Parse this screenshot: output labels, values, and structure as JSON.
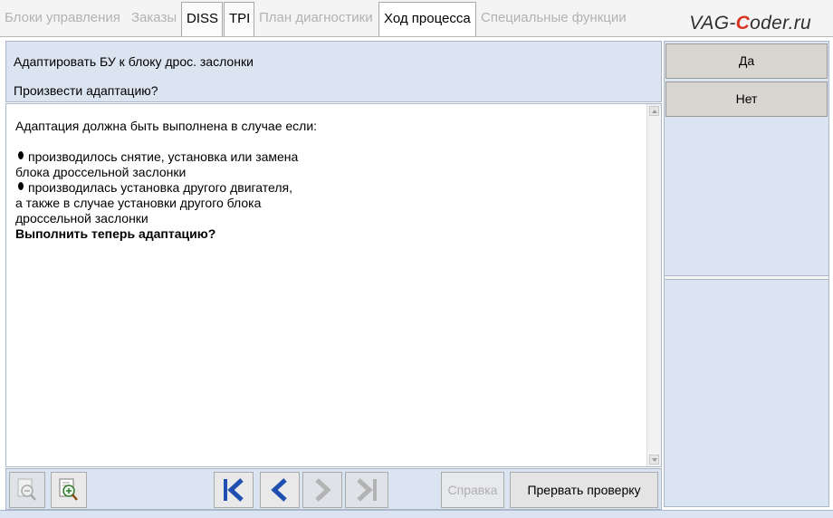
{
  "tabs": [
    {
      "label": "Блоки управления",
      "enabled": false
    },
    {
      "label": "Заказы",
      "enabled": false
    },
    {
      "label": "DISS",
      "enabled": true
    },
    {
      "label": "TPI",
      "enabled": true
    },
    {
      "label": "План диагностики",
      "enabled": false
    },
    {
      "label": "Ход процесса",
      "enabled": true,
      "active": true
    },
    {
      "label": "Специальные функции",
      "enabled": false
    }
  ],
  "logo": {
    "prefix": "VAG-",
    "accent": "C",
    "suffix": "oder.ru"
  },
  "header": {
    "line1": "Адаптировать БУ к блоку дрос. заслонки",
    "line2": "Произвести адаптацию?"
  },
  "content": {
    "intro": "Адаптация должна быть выполнена в случае если:",
    "bullet1_line1": "производилось снятие, установка или замена",
    "bullet1_line2": "блока дроссельной заслонки",
    "bullet2_line1": "производилась установка другого двигателя,",
    "bullet2_line2": "а также в случае установки другого блока",
    "bullet2_line3": "дроссельной заслонки",
    "question": "Выполнить теперь адаптацию?"
  },
  "answers": {
    "yes": "Да",
    "no": "Нет"
  },
  "toolbar": {
    "help_label": "Справка",
    "abort_label": "Прервать проверку"
  },
  "colors": {
    "panel": "#dbe5f1",
    "border": "#a9b7c8",
    "nav_arrow": "#1f4fb0",
    "logo_accent": "#d7321f"
  }
}
